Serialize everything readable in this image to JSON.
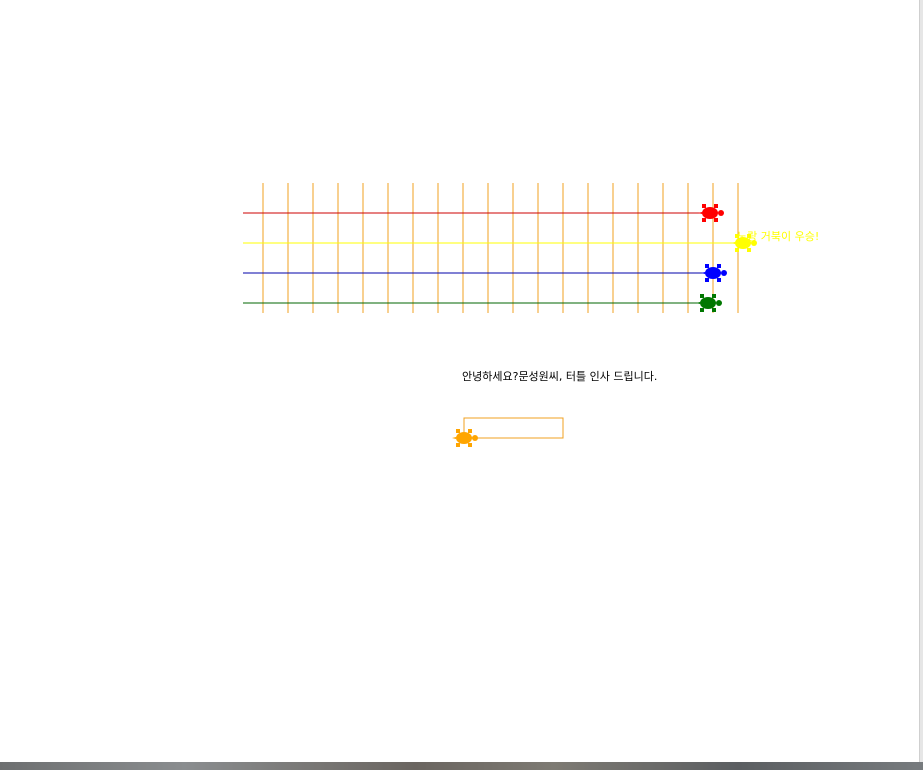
{
  "race": {
    "track_colors": {
      "grid": "#f0a020",
      "red": "#cc0000",
      "yellow": "#ffff00",
      "blue": "#0000aa",
      "green": "#006600"
    },
    "turtles": [
      {
        "name": "red",
        "color": "#ff0000",
        "icon": "turtle-icon"
      },
      {
        "name": "yellow",
        "color": "#ffff00",
        "icon": "turtle-icon"
      },
      {
        "name": "blue",
        "color": "#0000ff",
        "icon": "turtle-icon"
      },
      {
        "name": "green",
        "color": "#007700",
        "icon": "turtle-icon"
      }
    ],
    "winner_text": "노랑 거북이 우승!"
  },
  "greeting": {
    "text": "안녕하세요?문성원씨, 터틀 인사 드립니다."
  },
  "input_turtle": {
    "color": "#ffa500",
    "icon": "turtle-icon"
  }
}
